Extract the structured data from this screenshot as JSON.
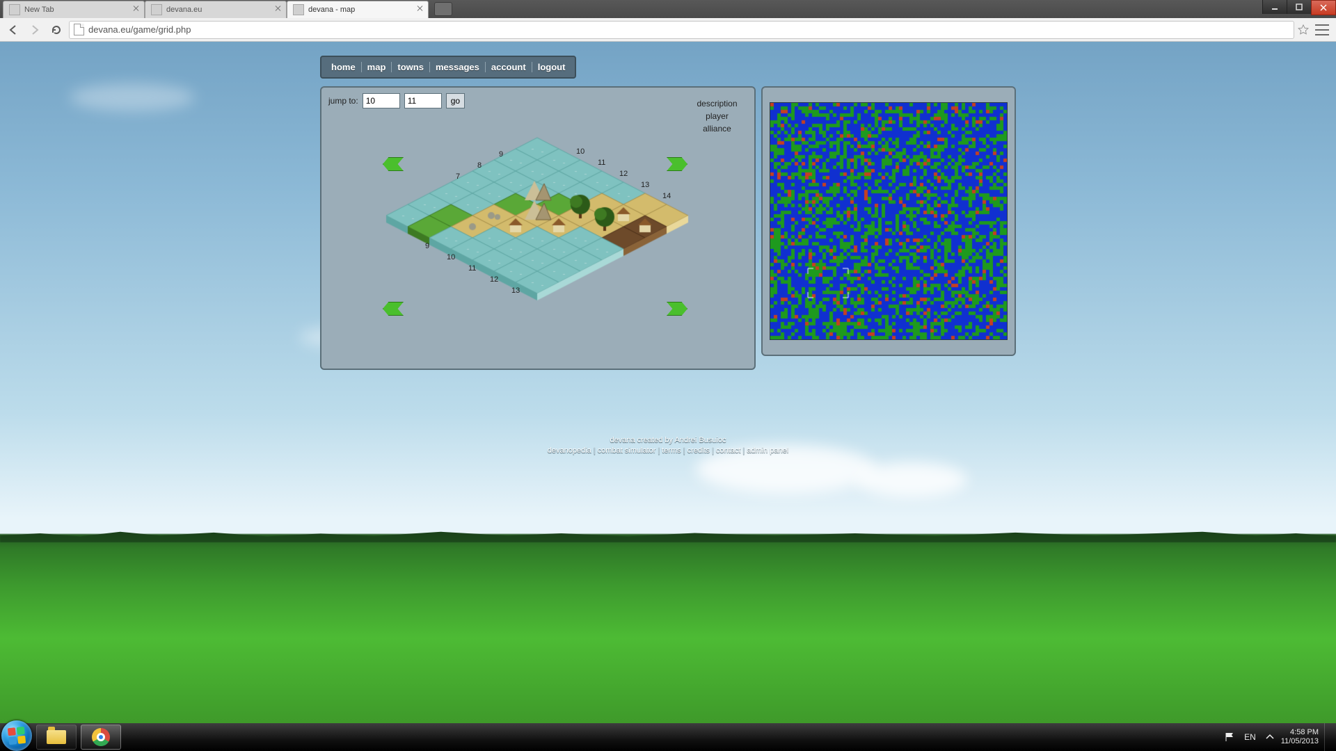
{
  "browser": {
    "tabs": [
      {
        "title": "New Tab",
        "active": false
      },
      {
        "title": "devana.eu",
        "active": false
      },
      {
        "title": "devana - map",
        "active": true
      }
    ],
    "url": "devana.eu/game/grid.php"
  },
  "nav": {
    "items": [
      "home",
      "map",
      "towns",
      "messages",
      "account",
      "logout"
    ]
  },
  "map_panel": {
    "jump_label": "jump to:",
    "x": "10",
    "y": "11",
    "go_label": "go",
    "info": {
      "l1": "description",
      "l2": "player",
      "l3": "alliance"
    },
    "axis_top": [
      "14",
      "13",
      "12",
      "11",
      "10"
    ],
    "axis_left": [
      "9",
      "8",
      "7"
    ],
    "axis_bottom_left": [
      "9",
      "10",
      "11",
      "12",
      "13"
    ],
    "terrain_note": "Isometric 7×7 neighborhood around (10,11): mostly sea tiles with a cluster of land/desert, mountains top-left of cluster, trees center-right, a few village huts."
  },
  "minimap": {
    "size": 340,
    "seed": 1011,
    "viewport_tiles": 7
  },
  "credits": {
    "line1": "devana created by Andrei Busuioc",
    "links": [
      "devanopedia",
      "combat simulator",
      "terms",
      "credits",
      "contact",
      "admin panel"
    ]
  },
  "taskbar": {
    "lang": "EN",
    "time": "4:58 PM",
    "date": "11/05/2013"
  }
}
